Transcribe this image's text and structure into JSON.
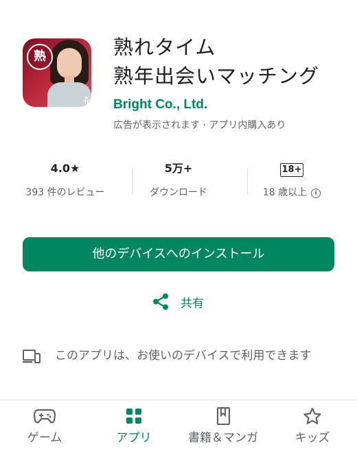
{
  "app": {
    "icon_badge": "熟",
    "icon_corner_text": "쥬",
    "title_line1": "熟れタイム",
    "title_line2": "熟年出会いマッチング",
    "developer": "Bright Co., Ltd.",
    "meta_note": "広告が表示されます · アプリ内購入あり"
  },
  "stats": {
    "rating_value": "4.0★",
    "rating_label": "393 件のレビュー",
    "downloads_value": "5万+",
    "downloads_label": "ダウンロード",
    "age_badge": "18+",
    "age_label": "18 歳以上",
    "info_glyph": "i"
  },
  "actions": {
    "install_label": "他のデバイスへのインストール",
    "share_label": "共有"
  },
  "device_notice": "このアプリは、お使いのデバイスで利用できます",
  "nav": {
    "items": [
      {
        "label": "ゲーム",
        "icon": "gamepad-icon"
      },
      {
        "label": "アプリ",
        "icon": "apps-grid-icon",
        "active": true
      },
      {
        "label": "書籍＆マンガ",
        "icon": "bookmark-book-icon"
      },
      {
        "label": "キッズ",
        "icon": "star-icon"
      }
    ]
  },
  "colors": {
    "accent": "#01875f",
    "text_secondary": "#5f6368",
    "text_primary": "#202124"
  }
}
